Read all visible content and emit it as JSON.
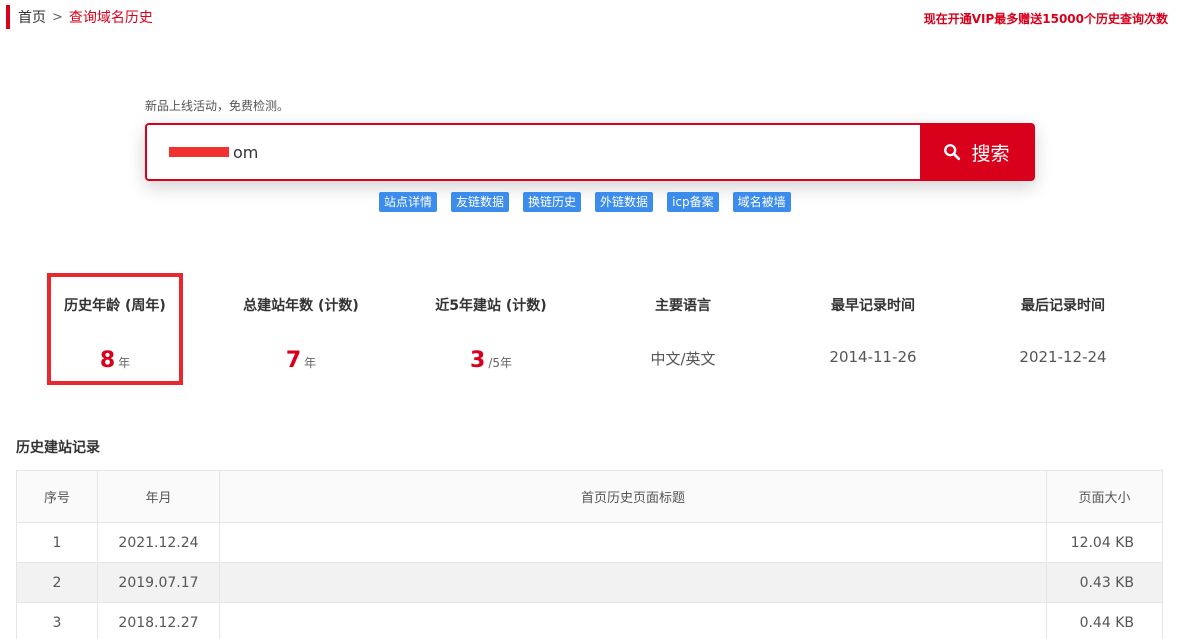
{
  "breadcrumb": {
    "home": "首页",
    "separator": ">",
    "current": "查询域名历史"
  },
  "promo_text": "现在开通VIP最多赠送15000个历史查询次数",
  "search": {
    "hint": "新品上线活动，免费检测。",
    "value": "om",
    "button_label": "搜索"
  },
  "tags": [
    "站点详情",
    "友链数据",
    "换链历史",
    "外链数据",
    "icp备案",
    "域名被墙"
  ],
  "stats": [
    {
      "label": "历史年龄 (周年)",
      "value": "8",
      "unit": "年"
    },
    {
      "label": "总建站年数 (计数)",
      "value": "7",
      "unit": "年"
    },
    {
      "label": "近5年建站 (计数)",
      "value": "3",
      "unit": "/5年"
    },
    {
      "label": "主要语言",
      "value": "中文/英文"
    },
    {
      "label": "最早记录时间",
      "value": "2014-11-26"
    },
    {
      "label": "最后记录时间",
      "value": "2021-12-24"
    }
  ],
  "history": {
    "title": "历史建站记录",
    "columns": [
      "序号",
      "年月",
      "首页历史页面标题",
      "页面大小"
    ],
    "rows": [
      {
        "index": "1",
        "date": "2021.12.24",
        "title": "",
        "size": "12.04 KB"
      },
      {
        "index": "2",
        "date": "2019.07.17",
        "title": "",
        "size": "0.43 KB"
      },
      {
        "index": "3",
        "date": "2018.12.27",
        "title": "",
        "size": "0.44 KB"
      }
    ]
  },
  "colors": {
    "accent": "#d9001b",
    "tag_blue": "#3b8ced",
    "highlight": "#e8272e"
  }
}
